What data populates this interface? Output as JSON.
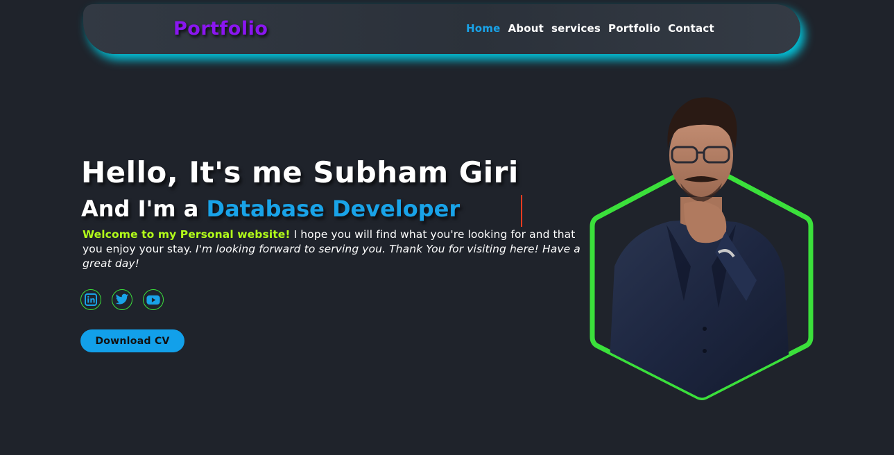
{
  "header": {
    "logo": "Portfolio",
    "nav": [
      {
        "label": "Home",
        "active": true
      },
      {
        "label": "About",
        "active": false
      },
      {
        "label": "services",
        "active": false
      },
      {
        "label": "Portfolio",
        "active": false
      },
      {
        "label": "Contact",
        "active": false
      }
    ]
  },
  "hero": {
    "title": "Hello, It's me Subham Giri",
    "subtitle_prefix": "And I'm a",
    "role": "Database Developer",
    "intro_welcome": "Welcome to my Personal website!",
    "intro_text": " I hope you will find what you're looking for and that you enjoy your stay.",
    "intro_italic": " I'm looking forward to serving you. Thank You for visiting here! Have a great day!"
  },
  "socials": [
    {
      "icon": "linkedin-icon"
    },
    {
      "icon": "twitter-icon"
    },
    {
      "icon": "youtube-icon"
    }
  ],
  "cta": {
    "download_label": "Download CV"
  },
  "colors": {
    "background": "#1f232b",
    "accent_blue": "#19a3e8",
    "accent_purple": "#8a16f0",
    "accent_green": "#3be03b",
    "welcome_green": "#b3ff1a",
    "header_glow": "#00e5ff",
    "cursor_red": "#ff3b1f"
  }
}
